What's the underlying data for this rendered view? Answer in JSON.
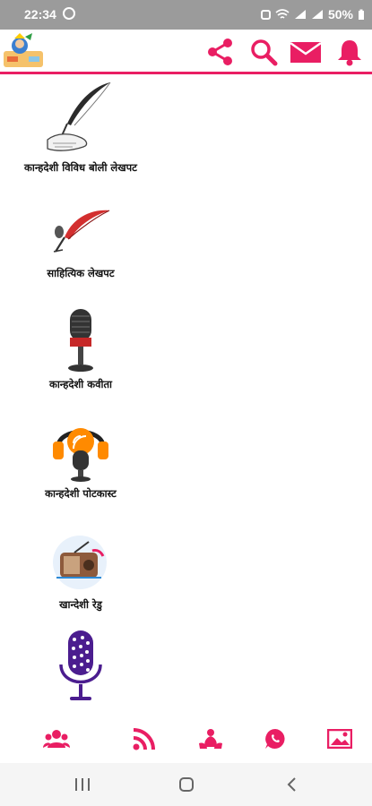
{
  "status_bar": {
    "time": "22:34",
    "battery": "50%",
    "icons": [
      "whatsapp-icon",
      "alarm-icon",
      "wifi-icon",
      "signal-icon",
      "signal-icon",
      "battery-icon"
    ]
  },
  "app_bar": {
    "logo": "krishna-logo",
    "actions": [
      "share-icon",
      "search-icon",
      "mail-icon",
      "bell-icon"
    ],
    "accent_color": "#e91e63"
  },
  "menu": {
    "items": [
      {
        "label": "कान्हदेशी विविध बोली लेखपट",
        "icon": "quill-pen-icon"
      },
      {
        "label": "साहित्यिक लेखपट",
        "icon": "red-feather-icon"
      },
      {
        "label": "कान्हदेशी कवीता",
        "icon": "microphone-icon"
      },
      {
        "label": "कान्हदेशी पोटकास्ट",
        "icon": "podcast-mic-icon"
      },
      {
        "label": "खान्देशी रेडु",
        "icon": "radio-icon"
      },
      {
        "label": "",
        "icon": "purple-microphone-icon"
      }
    ]
  },
  "bottom_bar": {
    "items": [
      "group-icon",
      "rss-icon",
      "lotus-icon",
      "whatsapp-icon",
      "gallery-icon"
    ],
    "color": "#e91e63"
  },
  "nav_bar": {
    "items": [
      "recents-icon",
      "home-icon",
      "back-icon"
    ]
  }
}
